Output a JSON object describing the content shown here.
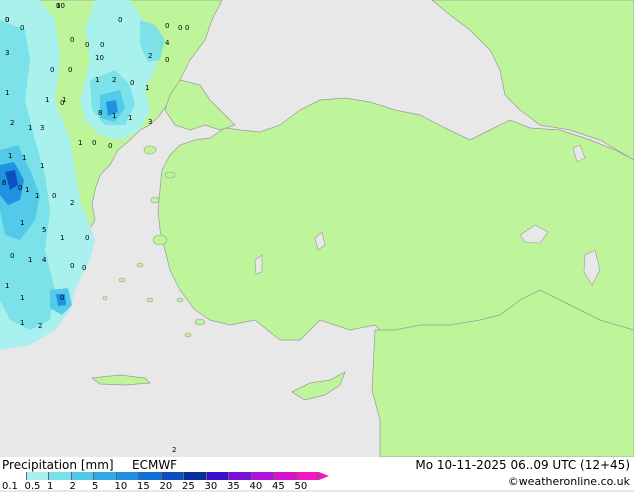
{
  "title": "Precipitation [mm]",
  "model": "ECMWF",
  "timestamp": "Mo 10-11-2025 06..09 UTC (12+45)",
  "credit": "©weatheronline.co.uk",
  "colors": {
    "land": "#bff59a",
    "sea": "#e8e8e8",
    "coast": "#999999"
  },
  "scale": {
    "labels": [
      "0.1",
      "0.5",
      "1",
      "2",
      "5",
      "10",
      "15",
      "20",
      "25",
      "30",
      "35",
      "40",
      "45",
      "50"
    ],
    "colors": [
      "#ffffff",
      "#a8f0f0",
      "#78e0ea",
      "#50c8e8",
      "#30aae6",
      "#1e8ee0",
      "#1070d6",
      "#0a4fc2",
      "#0a2e9e",
      "#3a10c8",
      "#7a10d8",
      "#b010e0",
      "#d810d0",
      "#f018c0"
    ]
  },
  "grid_values": [
    "0",
    "0",
    "0",
    "0",
    "0",
    "0",
    "0",
    "2",
    "0",
    "0",
    "0",
    "0",
    "0",
    "0",
    "1",
    "2",
    "0",
    "1",
    "1",
    "2",
    "1",
    "3",
    "1",
    "0",
    "1",
    "0",
    "0",
    "1",
    "1",
    "1",
    "1",
    "0",
    "8",
    "1",
    "1",
    "1",
    "3",
    "6",
    "0",
    "1",
    "2",
    "1",
    "5",
    "0",
    "1",
    "1",
    "4",
    "1",
    "0",
    "1",
    "0",
    "1",
    "2",
    "0",
    "0",
    "2",
    "3",
    "10",
    "4",
    "10",
    "0"
  ]
}
